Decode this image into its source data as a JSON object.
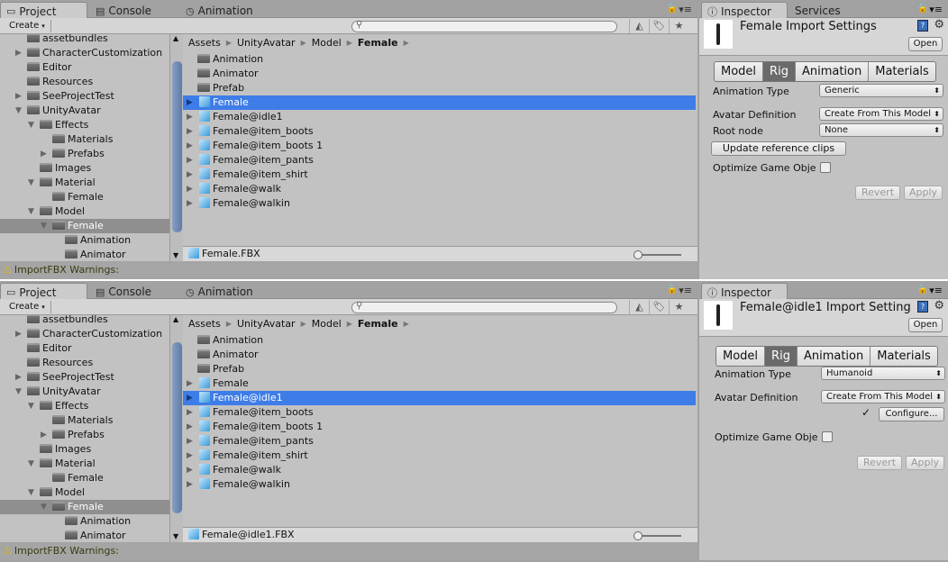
{
  "panels": [
    {
      "tabs": {
        "project": "Project",
        "console": "Console",
        "animation": "Animation"
      },
      "toolbar": {
        "create": "Create"
      },
      "tree": [
        {
          "label": "assetbundles",
          "level": 1,
          "arrow": ""
        },
        {
          "label": "CharacterCustomization",
          "level": 1,
          "arrow": "right"
        },
        {
          "label": "Editor",
          "level": 1,
          "arrow": ""
        },
        {
          "label": "Resources",
          "level": 1,
          "arrow": ""
        },
        {
          "label": "SeeProjectTest",
          "level": 1,
          "arrow": "right"
        },
        {
          "label": "UnityAvatar",
          "level": 1,
          "arrow": "down"
        },
        {
          "label": "Effects",
          "level": 2,
          "arrow": "down"
        },
        {
          "label": "Materials",
          "level": 3,
          "arrow": ""
        },
        {
          "label": "Prefabs",
          "level": 3,
          "arrow": "right"
        },
        {
          "label": "Images",
          "level": 2,
          "arrow": ""
        },
        {
          "label": "Material",
          "level": 2,
          "arrow": "down"
        },
        {
          "label": "Female",
          "level": 3,
          "arrow": ""
        },
        {
          "label": "Model",
          "level": 2,
          "arrow": "down"
        },
        {
          "label": "Female",
          "level": 3,
          "arrow": "down",
          "selected": true
        },
        {
          "label": "Animation",
          "level": 4,
          "arrow": ""
        },
        {
          "label": "Animator",
          "level": 4,
          "arrow": ""
        }
      ],
      "breadcrumb": [
        "Assets",
        "UnityAvatar",
        "Model",
        "Female"
      ],
      "items": [
        {
          "label": "Animation",
          "type": "folder"
        },
        {
          "label": "Animator",
          "type": "folder"
        },
        {
          "label": "Prefab",
          "type": "folder"
        },
        {
          "label": "Female",
          "type": "model",
          "selected": true
        },
        {
          "label": "Female@idle1",
          "type": "model"
        },
        {
          "label": "Female@item_boots",
          "type": "model"
        },
        {
          "label": "Female@item_boots 1",
          "type": "model"
        },
        {
          "label": "Female@item_pants",
          "type": "model"
        },
        {
          "label": "Female@item_shirt",
          "type": "model"
        },
        {
          "label": "Female@walk",
          "type": "model"
        },
        {
          "label": "Female@walkin",
          "type": "model"
        }
      ],
      "selected_file": "Female.FBX",
      "status": "ImportFBX Warnings:",
      "inspector": {
        "tabs": [
          "Inspector",
          "Services"
        ],
        "title": "Female Import Settings",
        "open": "Open",
        "seg": [
          "Model",
          "Rig",
          "Animation",
          "Materials"
        ],
        "active_seg": "Rig",
        "animation_type_label": "Animation Type",
        "animation_type": "Generic",
        "avatar_def_label": "Avatar Definition",
        "avatar_def": "Create From This Model",
        "root_node_label": "Root node",
        "root_node": "None",
        "update_clips": "Update reference clips",
        "optimize_label": "Optimize Game Obje",
        "revert": "Revert",
        "apply": "Apply"
      }
    },
    {
      "tabs": {
        "project": "Project",
        "console": "Console",
        "animation": "Animation"
      },
      "toolbar": {
        "create": "Create"
      },
      "tree": [
        {
          "label": "assetbundles",
          "level": 1,
          "arrow": ""
        },
        {
          "label": "CharacterCustomization",
          "level": 1,
          "arrow": "right"
        },
        {
          "label": "Editor",
          "level": 1,
          "arrow": ""
        },
        {
          "label": "Resources",
          "level": 1,
          "arrow": ""
        },
        {
          "label": "SeeProjectTest",
          "level": 1,
          "arrow": "right"
        },
        {
          "label": "UnityAvatar",
          "level": 1,
          "arrow": "down"
        },
        {
          "label": "Effects",
          "level": 2,
          "arrow": "down"
        },
        {
          "label": "Materials",
          "level": 3,
          "arrow": ""
        },
        {
          "label": "Prefabs",
          "level": 3,
          "arrow": "right"
        },
        {
          "label": "Images",
          "level": 2,
          "arrow": ""
        },
        {
          "label": "Material",
          "level": 2,
          "arrow": "down"
        },
        {
          "label": "Female",
          "level": 3,
          "arrow": ""
        },
        {
          "label": "Model",
          "level": 2,
          "arrow": "down"
        },
        {
          "label": "Female",
          "level": 3,
          "arrow": "down",
          "selected": true
        },
        {
          "label": "Animation",
          "level": 4,
          "arrow": ""
        },
        {
          "label": "Animator",
          "level": 4,
          "arrow": ""
        }
      ],
      "breadcrumb": [
        "Assets",
        "UnityAvatar",
        "Model",
        "Female"
      ],
      "items": [
        {
          "label": "Animation",
          "type": "folder"
        },
        {
          "label": "Animator",
          "type": "folder"
        },
        {
          "label": "Prefab",
          "type": "folder"
        },
        {
          "label": "Female",
          "type": "model"
        },
        {
          "label": "Female@idle1",
          "type": "model",
          "selected": true
        },
        {
          "label": "Female@item_boots",
          "type": "model"
        },
        {
          "label": "Female@item_boots 1",
          "type": "model"
        },
        {
          "label": "Female@item_pants",
          "type": "model"
        },
        {
          "label": "Female@item_shirt",
          "type": "model"
        },
        {
          "label": "Female@walk",
          "type": "model"
        },
        {
          "label": "Female@walkin",
          "type": "model"
        }
      ],
      "selected_file": "Female@idle1.FBX",
      "status": "ImportFBX Warnings:",
      "inspector": {
        "tabs": [
          "Inspector"
        ],
        "title": "Female@idle1 Import Settings",
        "open": "Open",
        "seg": [
          "Model",
          "Rig",
          "Animation",
          "Materials"
        ],
        "active_seg": "Rig",
        "animation_type_label": "Animation Type",
        "animation_type": "Humanoid",
        "avatar_def_label": "Avatar Definition",
        "avatar_def": "Create From This Model",
        "configured_check": "✓",
        "configure": "Configure...",
        "optimize_label": "Optimize Game Obje",
        "revert": "Revert",
        "apply": "Apply"
      }
    }
  ],
  "colors": {
    "selection_blue": "#3e7de7",
    "tree_selected": "#8f8f8f",
    "warning": "#e6b800"
  }
}
